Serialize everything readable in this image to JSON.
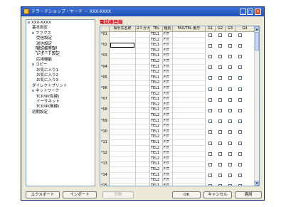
{
  "window": {
    "title": "テラ－ドショップ・ヤード － XXX-XXXX"
  },
  "tree": {
    "items": [
      {
        "label": "XXX-XXXX",
        "expander": "⊟",
        "level": 0
      },
      {
        "label": "基本設定",
        "expander": "",
        "level": 1
      },
      {
        "label": "ファクス",
        "expander": "⊟",
        "level": 1
      },
      {
        "label": "受信設定",
        "expander": "",
        "level": 2
      },
      {
        "label": "送信設定",
        "expander": "",
        "level": 2
      },
      {
        "label": "電話帳登録",
        "expander": "",
        "level": 2,
        "selected": true
      },
      {
        "label": "レポート設定",
        "expander": "",
        "level": 2
      },
      {
        "label": "応用機能",
        "expander": "",
        "level": 2
      },
      {
        "label": "コピー",
        "expander": "⊟",
        "level": 1
      },
      {
        "label": "お気に入り1",
        "expander": "",
        "level": 2
      },
      {
        "label": "お気に入り2",
        "expander": "",
        "level": 2
      },
      {
        "label": "お気に入り3",
        "expander": "",
        "level": 2
      },
      {
        "label": "ダイレクトプリント",
        "expander": "",
        "level": 1
      },
      {
        "label": "ネットワーク",
        "expander": "⊟",
        "level": 1
      },
      {
        "label": "TCP/IP(有線)",
        "expander": "",
        "level": 2
      },
      {
        "label": "イーサネット",
        "expander": "",
        "level": 2
      },
      {
        "label": "TCP/IP(無線)",
        "expander": "",
        "level": 2
      },
      {
        "label": "初期設定",
        "expander": "",
        "level": 1
      }
    ]
  },
  "phonebook": {
    "section_title": "電話帳登録",
    "columns": [
      "",
      "相手先名称",
      "ヨミガナ",
      "TEL",
      "種別",
      "FAX/TEL 番号",
      "G1",
      "G2",
      "G3",
      "G4"
    ],
    "rows": [
      {
        "num": "*01",
        "name": "",
        "reading": "",
        "tel": [
          "TEL1",
          "TEL2"
        ],
        "type": [
          "F/T",
          "F/T"
        ]
      },
      {
        "num": "*02",
        "name": "",
        "reading": "",
        "tel": [
          "TEL1",
          "TEL2"
        ],
        "type": [
          "F/T",
          "F/T"
        ]
      },
      {
        "num": "*03",
        "name": "",
        "reading": "",
        "tel": [
          "TEL1",
          "TEL2"
        ],
        "type": [
          "F/T",
          "F/T"
        ]
      },
      {
        "num": "*04",
        "name": "",
        "reading": "",
        "tel": [
          "TEL1",
          "TEL2"
        ],
        "type": [
          "F/T",
          "F/T"
        ]
      },
      {
        "num": "*05",
        "name": "",
        "reading": "",
        "tel": [
          "TEL1",
          "TEL2"
        ],
        "type": [
          "F/T",
          "F/T"
        ]
      },
      {
        "num": "*06",
        "name": "",
        "reading": "",
        "tel": [
          "TEL1",
          "TEL2"
        ],
        "type": [
          "F/T",
          "F/T"
        ]
      },
      {
        "num": "*07",
        "name": "",
        "reading": "",
        "tel": [
          "TEL1",
          "TEL2"
        ],
        "type": [
          "F/T",
          "F/T"
        ]
      },
      {
        "num": "*08",
        "name": "",
        "reading": "",
        "tel": [
          "TEL1",
          "TEL2"
        ],
        "type": [
          "F/T",
          "F/T"
        ]
      },
      {
        "num": "*09",
        "name": "",
        "reading": "",
        "tel": [
          "TEL1",
          "TEL2"
        ],
        "type": [
          "F/T",
          "F/T"
        ]
      },
      {
        "num": "*10",
        "name": "",
        "reading": "",
        "tel": [
          "TEL1",
          "TEL2"
        ],
        "type": [
          "F/T",
          "F/T"
        ]
      },
      {
        "num": "*11",
        "name": "",
        "reading": "",
        "tel": [
          "TEL1",
          "TEL2"
        ],
        "type": [
          "F/T",
          "F/T"
        ]
      },
      {
        "num": "*12",
        "name": "",
        "reading": "",
        "tel": [
          "TEL1",
          "TEL2"
        ],
        "type": [
          "F/T",
          "F/T"
        ]
      },
      {
        "num": "*13",
        "name": "",
        "reading": "",
        "tel": [
          "TEL1",
          "TEL2"
        ],
        "type": [
          "F/T",
          "F/T"
        ]
      },
      {
        "num": "*14",
        "name": "",
        "reading": "",
        "tel": [
          "TEL1",
          "TEL2"
        ],
        "type": [
          "F/T",
          "F/T"
        ]
      },
      {
        "num": "*15",
        "name": "",
        "reading": "",
        "tel": [
          "TEL1",
          "TEL2"
        ],
        "type": [
          "F/T",
          "F/T"
        ]
      },
      {
        "num": "*16",
        "name": "",
        "reading": "",
        "tel": [
          "TEL1",
          "TEL2"
        ],
        "type": [
          "F/T",
          "F/T"
        ]
      }
    ]
  },
  "buttons": {
    "export": "エクスポート",
    "import": "インポート",
    "print": "印刷",
    "ok": "OK",
    "cancel": "キャンセル",
    "apply": "適用"
  },
  "icons": {
    "app": "app-icon",
    "minimize": "minimize-icon",
    "maximize": "maximize-icon",
    "close": "close-icon"
  },
  "colors": {
    "titlebar": "#2456c4",
    "section_title": "#e0001a"
  }
}
